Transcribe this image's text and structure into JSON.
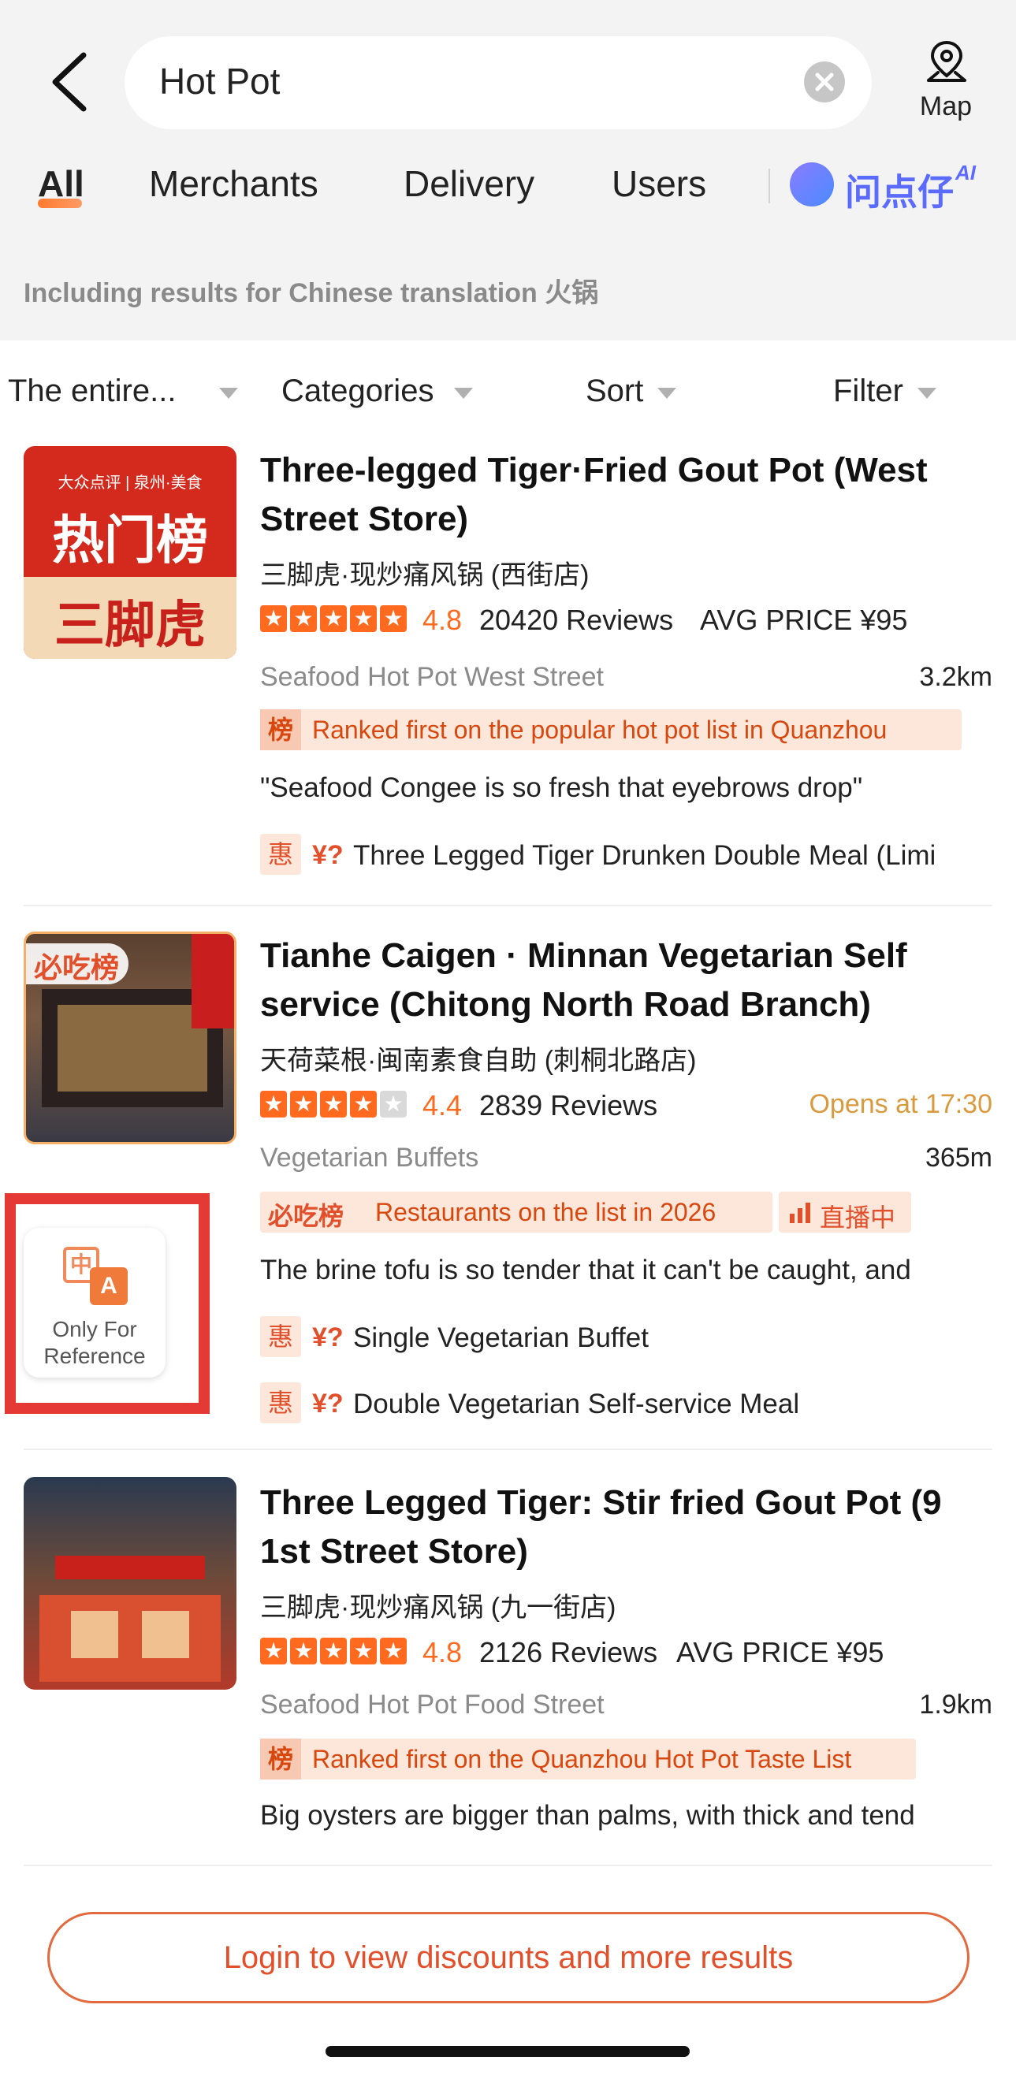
{
  "header": {
    "search_query": "Hot Pot",
    "map_label": "Map",
    "tabs": [
      {
        "label": "All",
        "active": true
      },
      {
        "label": "Merchants"
      },
      {
        "label": "Delivery"
      },
      {
        "label": "Users"
      }
    ],
    "ai_label": "问点仔",
    "ai_badge": "AI",
    "translation_note": "Including results for Chinese translation 火锅"
  },
  "filters": [
    {
      "label": "The entire..."
    },
    {
      "label": "Categories"
    },
    {
      "label": "Sort"
    },
    {
      "label": "Filter"
    }
  ],
  "results": [
    {
      "title": "Three-legged Tiger·Fried Gout Pot (West Street Store)",
      "name_cn": "三脚虎·现炒痛风锅 (西街店)",
      "thumb_text_top": "大众点评 | 泉州·美食",
      "thumb_text_mid": "热门榜",
      "thumb_text_bottom": "三脚虎",
      "rating": "4.8",
      "stars": 5,
      "reviews": "20420 Reviews",
      "avg_price": "AVG PRICE ¥95",
      "category": "Seafood Hot Pot  West Street",
      "distance": "3.2km",
      "rank_icon": "榜",
      "rank_text": "Ranked first on the popular hot pot list in Quanzhou",
      "quote": "\"Seafood Congee is so fresh that eyebrows drop\"",
      "deals": [
        {
          "icon": "惠",
          "price": "¥?",
          "text": "Three Legged Tiger Drunken Double Meal (Limi"
        }
      ]
    },
    {
      "title": "Tianhe Caigen · Minnan Vegetarian Self service (Chitong North Road Branch)",
      "name_cn": "天荷菜根·闽南素食自助 (刺桐北路店)",
      "thumb_badge": "必吃榜",
      "rating": "4.4",
      "stars": 4,
      "reviews": "2839 Reviews",
      "opens": "Opens at 17:30",
      "category": "Vegetarian Buffets",
      "distance": "365m",
      "list_badge": "必吃榜",
      "rank_text": "Restaurants on the list in 2026",
      "live_text": "直播中",
      "quote": "The brine tofu is so tender that it can't be caught, and",
      "deals": [
        {
          "icon": "惠",
          "price": "¥?",
          "text": "Single Vegetarian Buffet"
        },
        {
          "icon": "惠",
          "price": "¥?",
          "text": "Double Vegetarian Self-service Meal"
        }
      ]
    },
    {
      "title": "Three Legged Tiger: Stir fried Gout Pot (9 1st Street Store)",
      "name_cn": "三脚虎·现炒痛风锅 (九一街店)",
      "rating": "4.8",
      "stars": 5,
      "reviews": "2126 Reviews",
      "avg_price": "AVG PRICE ¥95",
      "category": "Seafood Hot Pot  Food Street",
      "distance": "1.9km",
      "rank_icon": "榜",
      "rank_text": "Ranked first on the Quanzhou Hot Pot Taste List",
      "quote": "Big oysters are bigger than palms, with thick and tend"
    }
  ],
  "overlay": {
    "text": "Only For Reference",
    "glyph_cn": "中",
    "glyph_en": "A"
  },
  "login_button": "Login to view discounts and more results"
}
